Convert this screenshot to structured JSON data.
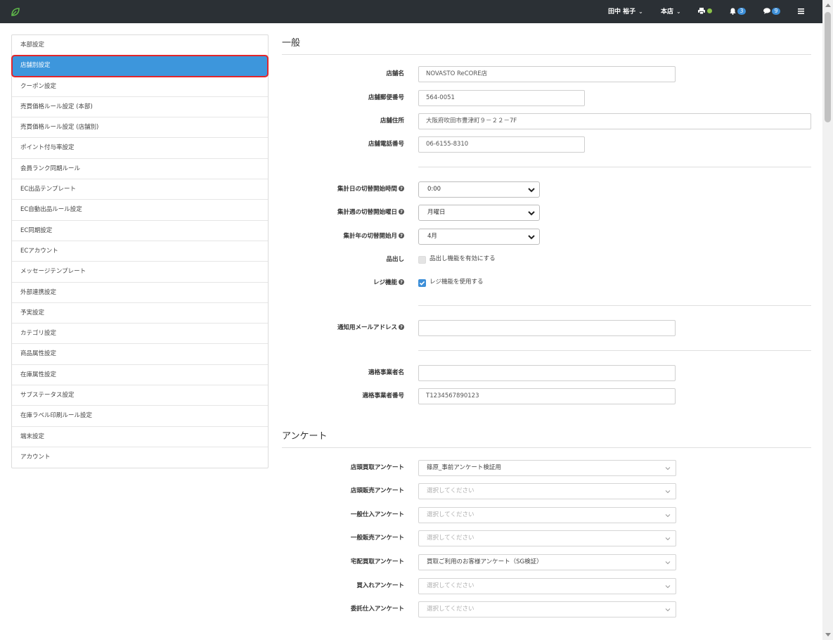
{
  "topbar": {
    "logo_icon": "leaf-logo",
    "user_name": "田中 裕子",
    "store_name": "本店",
    "notification_count": "3",
    "message_count": "9",
    "printer_status_color": "#8bc34a"
  },
  "sidebar": {
    "items": [
      {
        "label": "本部設定",
        "active": false
      },
      {
        "label": "店舗別設定",
        "active": true
      },
      {
        "label": "クーポン設定",
        "active": false
      },
      {
        "label": "売買価格ルール設定 (本部)",
        "active": false
      },
      {
        "label": "売買価格ルール設定 (店舗別)",
        "active": false
      },
      {
        "label": "ポイント付与率設定",
        "active": false
      },
      {
        "label": "会員ランク同期ルール",
        "active": false
      },
      {
        "label": "EC出品テンプレート",
        "active": false
      },
      {
        "label": "EC自動出品ルール設定",
        "active": false
      },
      {
        "label": "EC同期設定",
        "active": false
      },
      {
        "label": "ECアカウント",
        "active": false
      },
      {
        "label": "メッセージテンプレート",
        "active": false
      },
      {
        "label": "外部連携設定",
        "active": false
      },
      {
        "label": "予実設定",
        "active": false
      },
      {
        "label": "カテゴリ設定",
        "active": false
      },
      {
        "label": "商品属性設定",
        "active": false
      },
      {
        "label": "在庫属性設定",
        "active": false
      },
      {
        "label": "サブステータス設定",
        "active": false
      },
      {
        "label": "在庫ラベル印刷ルール設定",
        "active": false
      },
      {
        "label": "端末設定",
        "active": false
      },
      {
        "label": "アカウント",
        "active": false
      }
    ]
  },
  "general": {
    "title": "一般",
    "store_name": {
      "label": "店舗名",
      "value": "NOVASTO ReCORE店"
    },
    "postal_code": {
      "label": "店舗郵便番号",
      "value": "564-0051"
    },
    "address": {
      "label": "店舗住所",
      "value": "大阪府吹田市豊津町９－２２－7F"
    },
    "phone": {
      "label": "店舗電話番号",
      "value": "06-6155-8310"
    },
    "day_switch": {
      "label": "集計日の切替開始時間",
      "value": "0:00"
    },
    "week_switch": {
      "label": "集計週の切替開始曜日",
      "value": "月曜日"
    },
    "year_switch": {
      "label": "集計年の切替開始月",
      "value": "4月"
    },
    "display": {
      "label": "品出し",
      "checkbox_label": "品出し機能を有効にする",
      "checked": false
    },
    "register": {
      "label": "レジ機能",
      "checkbox_label": "レジ機能を使用する",
      "checked": true
    },
    "notify_email": {
      "label": "通知用メールアドレス",
      "value": ""
    },
    "invoice_name": {
      "label": "適格事業者名",
      "value": ""
    },
    "invoice_number": {
      "label": "適格事業者番号",
      "value": "T1234567890123"
    }
  },
  "survey": {
    "title": "アンケート",
    "placeholder": "選択してください",
    "rows": [
      {
        "label": "店頭買取アンケート",
        "value": "篠原_事前アンケート検証用"
      },
      {
        "label": "店頭販売アンケート",
        "value": ""
      },
      {
        "label": "一般仕入アンケート",
        "value": ""
      },
      {
        "label": "一般販売アンケート",
        "value": ""
      },
      {
        "label": "宅配買取アンケート",
        "value": "買取ご利用のお客様アンケート（SG検証）"
      },
      {
        "label": "買入れアンケート",
        "value": ""
      },
      {
        "label": "委託仕入アンケート",
        "value": ""
      }
    ]
  }
}
